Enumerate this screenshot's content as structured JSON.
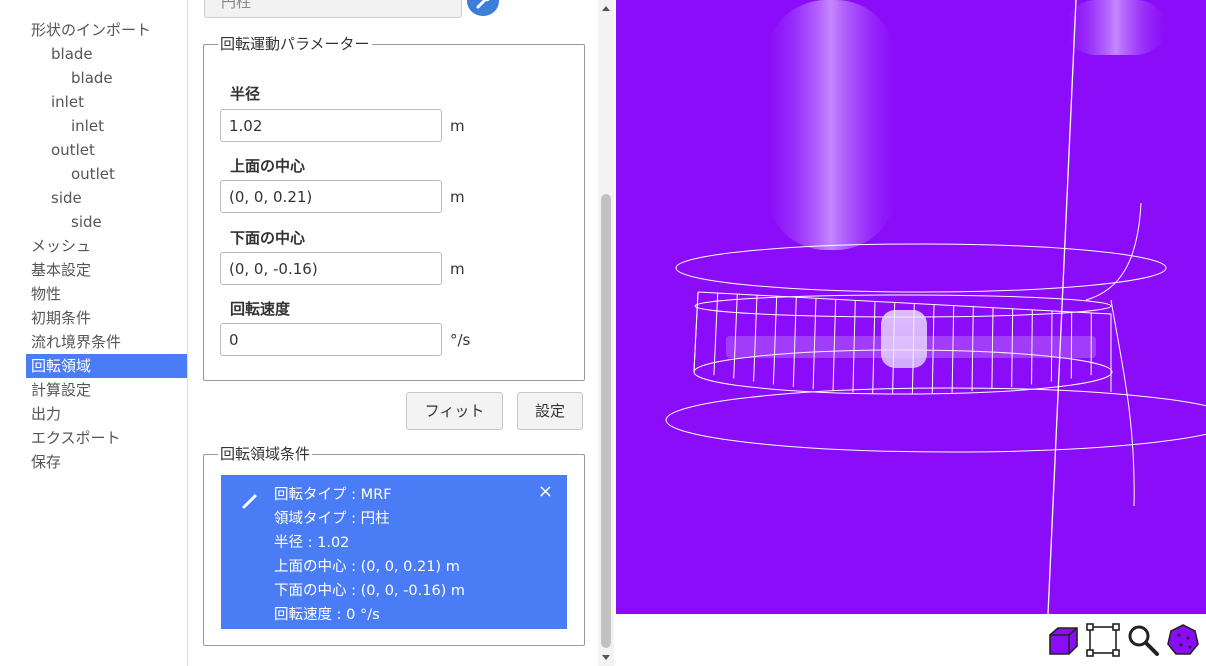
{
  "sidebar": {
    "items": [
      {
        "label": "形状のインポート"
      },
      {
        "label": "blade"
      },
      {
        "label": "blade"
      },
      {
        "label": "inlet"
      },
      {
        "label": "inlet"
      },
      {
        "label": "outlet"
      },
      {
        "label": "outlet"
      },
      {
        "label": "side"
      },
      {
        "label": "side"
      },
      {
        "label": "メッシュ"
      },
      {
        "label": "基本設定"
      },
      {
        "label": "物性"
      },
      {
        "label": "初期条件"
      },
      {
        "label": "流れ境界条件"
      },
      {
        "label": "回転領域"
      },
      {
        "label": "計算設定"
      },
      {
        "label": "出力"
      },
      {
        "label": "エクスポート"
      },
      {
        "label": "保存"
      }
    ],
    "selected": "回転領域"
  },
  "shape_select": {
    "value": "円柱"
  },
  "params": {
    "legend": "回転運動パラメーター",
    "radius": {
      "label": "半径",
      "value": "1.02",
      "unit": "m"
    },
    "top_center": {
      "label": "上面の中心",
      "value": "(0, 0, 0.21)",
      "unit": "m"
    },
    "bottom_center": {
      "label": "下面の中心",
      "value": "(0, 0, -0.16)",
      "unit": "m"
    },
    "speed": {
      "label": "回転速度",
      "value": "0",
      "unit": "°/s"
    }
  },
  "buttons": {
    "fit": "フィット",
    "set": "設定"
  },
  "conditions": {
    "legend": "回転領域条件",
    "close": "×",
    "lines": [
      "回転タイプ : MRF",
      "領域タイプ : 円柱",
      "半径 : 1.02",
      "上面の中心 : (0, 0, 0.21) m",
      "下面の中心 : (0, 0, -0.16) m",
      "回転速度 : 0 °/s"
    ]
  },
  "viewport": {
    "background": "#8a0cf8"
  },
  "toolbar": {
    "icons": [
      "box-view-icon",
      "fit-view-icon",
      "zoom-icon",
      "polyhedron-icon"
    ]
  }
}
